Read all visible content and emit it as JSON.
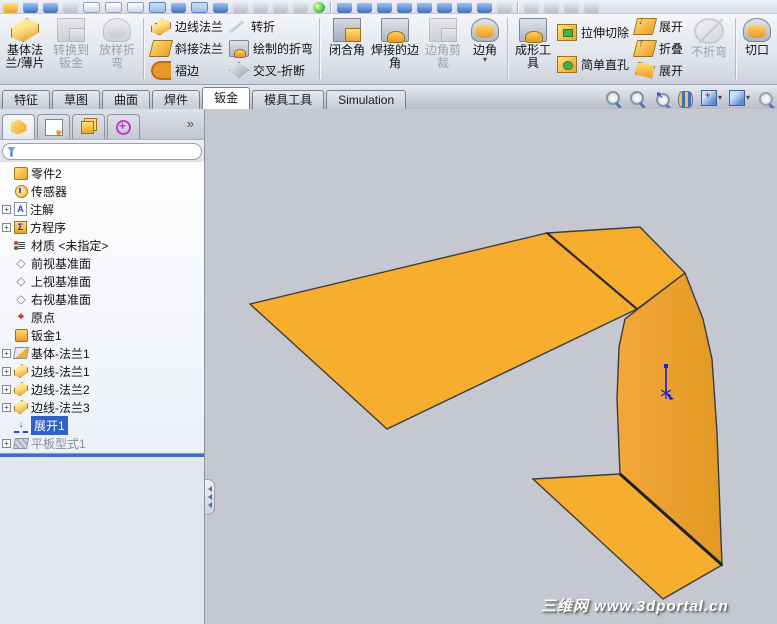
{
  "colors": {
    "part_orange": "#f7ae2f",
    "part_orange_dark": "#e49b28",
    "viewport_gray": "#c5c8d1",
    "selection_blue": "#3161c5",
    "rollback_blue": "#3f6ccd"
  },
  "ribbon": {
    "base_flange": "基体法兰/薄片",
    "convert_to_sheet_metal": "转换到钣金",
    "lofted_bend": "放样折弯",
    "edge_flange": "边线法兰",
    "miter_flange": "斜接法兰",
    "hem": "褶边",
    "jog": "转折",
    "sketched_bend": "绘制的折弯",
    "cross_break": "交叉-折断",
    "closed_corner": "闭合角",
    "welded_corner": "焊接的边角",
    "corner_trim": "边角剪裁",
    "corner": "边角",
    "forming_tool": "成形工具",
    "extruded_cut": "拉伸切除",
    "simple_hole": "简单直孔",
    "unfold": "展开",
    "fold": "折叠",
    "flatten": "展开",
    "no_bends": "不折弯",
    "rip": "切口",
    "corner_dropdown_caret": "▾"
  },
  "document_tabs": [
    {
      "label": "特征",
      "active": false
    },
    {
      "label": "草图",
      "active": false
    },
    {
      "label": "曲面",
      "active": false
    },
    {
      "label": "焊件",
      "active": false
    },
    {
      "label": "钣金",
      "active": true
    },
    {
      "label": "模具工具",
      "active": false
    },
    {
      "label": "Simulation",
      "active": false
    }
  ],
  "view_toolbar_icons": [
    "zoom-to-fit",
    "zoom-to-area",
    "previous-view",
    "section-view",
    "view-orientation",
    "display-style",
    "hide-show-items"
  ],
  "panel": {
    "tab_icons": [
      "featuremanager-tree",
      "propertymanager",
      "configurationmanager",
      "dimxpert"
    ],
    "overflow_chevron": "»",
    "filter_value": ""
  },
  "tree": {
    "items": [
      {
        "label": "零件2",
        "icon": "part",
        "expandable": false
      },
      {
        "label": "传感器",
        "icon": "sensors",
        "expandable": false
      },
      {
        "label": "注解",
        "icon": "annotations",
        "expandable": true
      },
      {
        "label": "方程序",
        "icon": "equations",
        "expandable": true
      },
      {
        "label": "材质 <未指定>",
        "icon": "material",
        "expandable": false
      },
      {
        "label": "前视基准面",
        "icon": "plane",
        "expandable": false
      },
      {
        "label": "上视基准面",
        "icon": "plane",
        "expandable": false
      },
      {
        "label": "右视基准面",
        "icon": "plane",
        "expandable": false
      },
      {
        "label": "原点",
        "icon": "origin",
        "expandable": false
      },
      {
        "label": "钣金1",
        "icon": "sheet-metal",
        "expandable": false
      },
      {
        "label": "基体-法兰1",
        "icon": "base-flange",
        "expandable": true
      },
      {
        "label": "边线-法兰1",
        "icon": "edge-flange",
        "expandable": true
      },
      {
        "label": "边线-法兰2",
        "icon": "edge-flange",
        "expandable": true
      },
      {
        "label": "边线-法兰3",
        "icon": "edge-flange",
        "expandable": true
      },
      {
        "label": "展开1",
        "icon": "unfold",
        "expandable": false,
        "selected": true
      },
      {
        "label": "平板型式1",
        "icon": "flat-pattern",
        "expandable": true,
        "grayed": true
      }
    ],
    "glyphs": {
      "annotations": "A",
      "equations": "Σ",
      "material": "≣",
      "plane": "◇",
      "origin": "⌖",
      "sheet_metal": "◎",
      "unfold": "↓"
    }
  },
  "watermark": "三维网 www.3dportal.cn"
}
